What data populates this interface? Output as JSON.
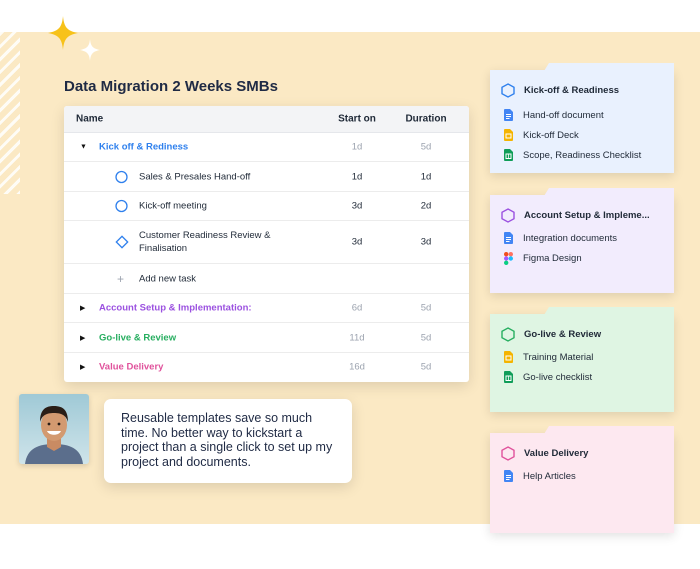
{
  "page": {
    "title": "Data Migration 2 Weeks SMBs"
  },
  "table": {
    "columns": {
      "name": "Name",
      "start": "Start on",
      "duration": "Duration"
    },
    "groups": [
      {
        "label": "Kick off & Rediness",
        "start": "1d",
        "duration": "5d",
        "expanded": true,
        "color": "#2f80ed"
      },
      {
        "label": "Account Setup & Implementation:",
        "start": "6d",
        "duration": "5d",
        "expanded": false,
        "color": "#9b51e0"
      },
      {
        "label": "Go-live & Review",
        "start": "11d",
        "duration": "5d",
        "expanded": false,
        "color": "#27ae60"
      },
      {
        "label": "Value Delivery",
        "start": "16d",
        "duration": "5d",
        "expanded": false,
        "color": "#e0529c"
      }
    ],
    "tasks": [
      {
        "label": "Sales & Presales Hand-off",
        "start": "1d",
        "duration": "1d",
        "icon": "circle-icon"
      },
      {
        "label": "Kick-off meeting",
        "start": "3d",
        "duration": "2d",
        "icon": "circle-icon"
      },
      {
        "label": "Customer Readiness Review & Finalisation",
        "start": "3d",
        "duration": "3d",
        "icon": "diamond-icon"
      }
    ],
    "add_task_label": "Add new task"
  },
  "testimonial": {
    "quote": "Reusable templates save so much time. No better way to kickstart a project than a single click to set up my project and documents."
  },
  "cards": [
    {
      "title": "Kick-off & Readiness",
      "bg": "#e9f1fe",
      "accent": "#2f80ed",
      "items": [
        {
          "label": "Hand-off document",
          "icon": "google-docs-icon"
        },
        {
          "label": "Kick-off Deck",
          "icon": "google-slides-icon"
        },
        {
          "label": "Scope, Readiness Checklist",
          "icon": "google-sheets-icon"
        }
      ]
    },
    {
      "title": "Account Setup & Impleme...",
      "bg": "#f2ecfd",
      "accent": "#9b51e0",
      "items": [
        {
          "label": "Integration documents",
          "icon": "google-docs-icon"
        },
        {
          "label": "Figma Design",
          "icon": "figma-icon"
        }
      ]
    },
    {
      "title": "Go-live & Review",
      "bg": "#dff5e3",
      "accent": "#27ae60",
      "items": [
        {
          "label": "Training Material",
          "icon": "google-slides-icon"
        },
        {
          "label": "Go-live checklist",
          "icon": "google-sheets-icon"
        }
      ]
    },
    {
      "title": "Value Delivery",
      "bg": "#fde8f0",
      "accent": "#e0529c",
      "items": [
        {
          "label": "Help Articles",
          "icon": "google-docs-icon"
        }
      ]
    }
  ]
}
